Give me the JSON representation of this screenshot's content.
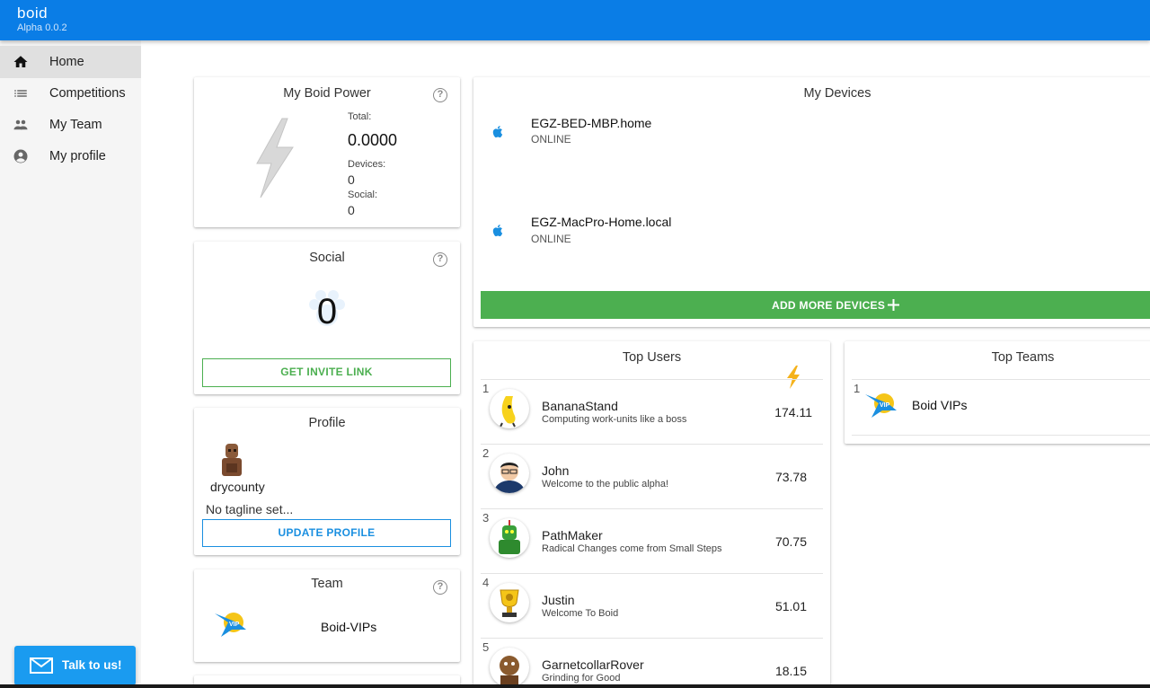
{
  "app": {
    "brand": "boid",
    "version": "Alpha 0.0.2"
  },
  "sidebar": {
    "items": [
      {
        "label": "Home",
        "icon": "home-icon"
      },
      {
        "label": "Competitions",
        "icon": "list-icon"
      },
      {
        "label": "My Team",
        "icon": "team-icon"
      },
      {
        "label": "My profile",
        "icon": "account-icon"
      }
    ],
    "active": "Home"
  },
  "talk": {
    "label": "Talk to us!"
  },
  "power": {
    "title": "My Boid Power",
    "total_label": "Total:",
    "total": "0.0000",
    "devices_label": "Devices:",
    "devices": "0",
    "social_label": "Social:",
    "social": "0"
  },
  "social": {
    "title": "Social",
    "count": "0",
    "invite_label": "GET INVITE LINK"
  },
  "profile": {
    "title": "Profile",
    "username": "drycounty",
    "tagline": "No tagline set...",
    "update_label": "UPDATE PROFILE"
  },
  "team": {
    "title": "Team",
    "name": "Boid-VIPs"
  },
  "devices": {
    "title": "My Devices",
    "items": [
      {
        "name": "EGZ-BED-MBP.home",
        "status": "ONLINE",
        "icon": "apple-icon"
      },
      {
        "name": "EGZ-MacPro-Home.local",
        "status": "ONLINE",
        "icon": "apple-icon"
      }
    ],
    "add_label": "ADD MORE DEVICES"
  },
  "top_users": {
    "title": "Top Users",
    "items": [
      {
        "rank": "1",
        "name": "BananaStand",
        "tagline": "Computing work-units like a boss",
        "score": "174.11"
      },
      {
        "rank": "2",
        "name": "John",
        "tagline": "Welcome to the public alpha!",
        "score": "73.78"
      },
      {
        "rank": "3",
        "name": "PathMaker",
        "tagline": "Radical Changes come from Small Steps",
        "score": "70.75"
      },
      {
        "rank": "4",
        "name": "Justin",
        "tagline": "Welcome To Boid",
        "score": "51.01"
      },
      {
        "rank": "5",
        "name": "GarnetcollarRover",
        "tagline": "Grinding for Good",
        "score": "18.15"
      }
    ]
  },
  "top_teams": {
    "title": "Top Teams",
    "items": [
      {
        "rank": "1",
        "name": "Boid VIPs"
      }
    ]
  },
  "colors": {
    "primary": "#0a7de6",
    "accent_green": "#4caf50",
    "bolt": "#f5b21b",
    "outline_blue": "#1a8fe0"
  }
}
